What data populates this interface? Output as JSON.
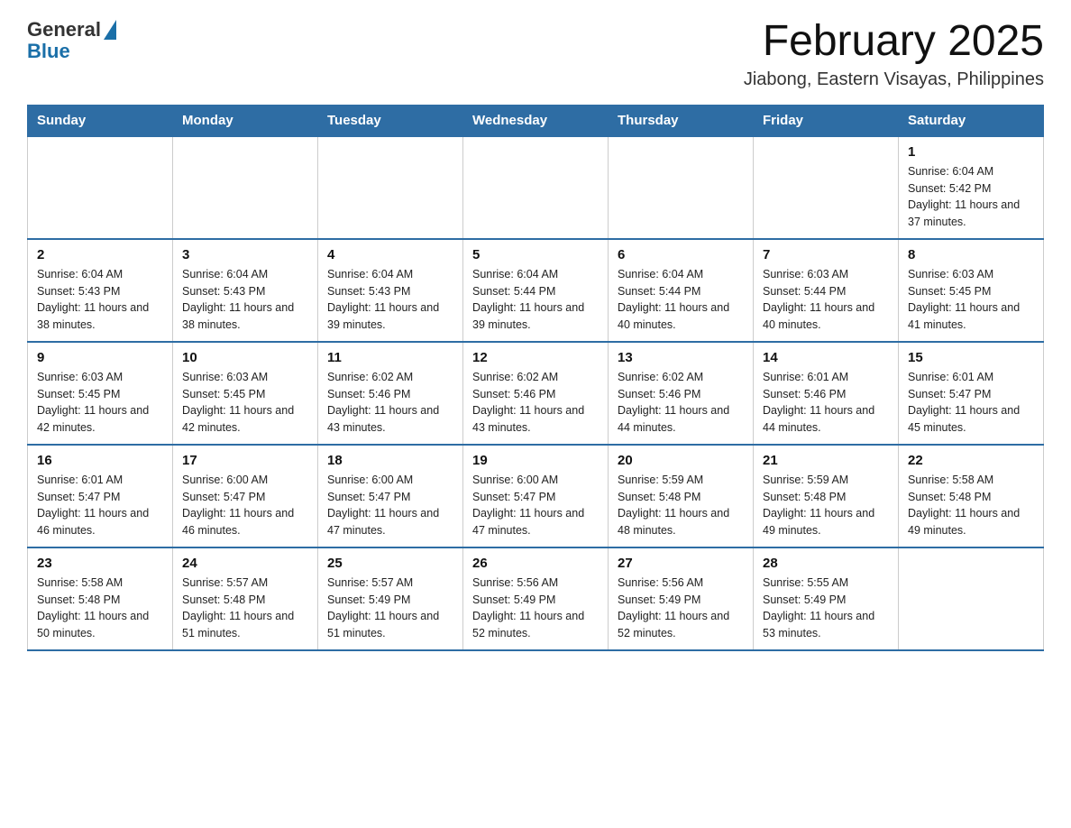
{
  "header": {
    "logo_general": "General",
    "logo_blue": "Blue",
    "main_title": "February 2025",
    "subtitle": "Jiabong, Eastern Visayas, Philippines"
  },
  "days_of_week": [
    "Sunday",
    "Monday",
    "Tuesday",
    "Wednesday",
    "Thursday",
    "Friday",
    "Saturday"
  ],
  "weeks": [
    [
      {
        "day": "",
        "sunrise": "",
        "sunset": "",
        "daylight": ""
      },
      {
        "day": "",
        "sunrise": "",
        "sunset": "",
        "daylight": ""
      },
      {
        "day": "",
        "sunrise": "",
        "sunset": "",
        "daylight": ""
      },
      {
        "day": "",
        "sunrise": "",
        "sunset": "",
        "daylight": ""
      },
      {
        "day": "",
        "sunrise": "",
        "sunset": "",
        "daylight": ""
      },
      {
        "day": "",
        "sunrise": "",
        "sunset": "",
        "daylight": ""
      },
      {
        "day": "1",
        "sunrise": "Sunrise: 6:04 AM",
        "sunset": "Sunset: 5:42 PM",
        "daylight": "Daylight: 11 hours and 37 minutes."
      }
    ],
    [
      {
        "day": "2",
        "sunrise": "Sunrise: 6:04 AM",
        "sunset": "Sunset: 5:43 PM",
        "daylight": "Daylight: 11 hours and 38 minutes."
      },
      {
        "day": "3",
        "sunrise": "Sunrise: 6:04 AM",
        "sunset": "Sunset: 5:43 PM",
        "daylight": "Daylight: 11 hours and 38 minutes."
      },
      {
        "day": "4",
        "sunrise": "Sunrise: 6:04 AM",
        "sunset": "Sunset: 5:43 PM",
        "daylight": "Daylight: 11 hours and 39 minutes."
      },
      {
        "day": "5",
        "sunrise": "Sunrise: 6:04 AM",
        "sunset": "Sunset: 5:44 PM",
        "daylight": "Daylight: 11 hours and 39 minutes."
      },
      {
        "day": "6",
        "sunrise": "Sunrise: 6:04 AM",
        "sunset": "Sunset: 5:44 PM",
        "daylight": "Daylight: 11 hours and 40 minutes."
      },
      {
        "day": "7",
        "sunrise": "Sunrise: 6:03 AM",
        "sunset": "Sunset: 5:44 PM",
        "daylight": "Daylight: 11 hours and 40 minutes."
      },
      {
        "day": "8",
        "sunrise": "Sunrise: 6:03 AM",
        "sunset": "Sunset: 5:45 PM",
        "daylight": "Daylight: 11 hours and 41 minutes."
      }
    ],
    [
      {
        "day": "9",
        "sunrise": "Sunrise: 6:03 AM",
        "sunset": "Sunset: 5:45 PM",
        "daylight": "Daylight: 11 hours and 42 minutes."
      },
      {
        "day": "10",
        "sunrise": "Sunrise: 6:03 AM",
        "sunset": "Sunset: 5:45 PM",
        "daylight": "Daylight: 11 hours and 42 minutes."
      },
      {
        "day": "11",
        "sunrise": "Sunrise: 6:02 AM",
        "sunset": "Sunset: 5:46 PM",
        "daylight": "Daylight: 11 hours and 43 minutes."
      },
      {
        "day": "12",
        "sunrise": "Sunrise: 6:02 AM",
        "sunset": "Sunset: 5:46 PM",
        "daylight": "Daylight: 11 hours and 43 minutes."
      },
      {
        "day": "13",
        "sunrise": "Sunrise: 6:02 AM",
        "sunset": "Sunset: 5:46 PM",
        "daylight": "Daylight: 11 hours and 44 minutes."
      },
      {
        "day": "14",
        "sunrise": "Sunrise: 6:01 AM",
        "sunset": "Sunset: 5:46 PM",
        "daylight": "Daylight: 11 hours and 44 minutes."
      },
      {
        "day": "15",
        "sunrise": "Sunrise: 6:01 AM",
        "sunset": "Sunset: 5:47 PM",
        "daylight": "Daylight: 11 hours and 45 minutes."
      }
    ],
    [
      {
        "day": "16",
        "sunrise": "Sunrise: 6:01 AM",
        "sunset": "Sunset: 5:47 PM",
        "daylight": "Daylight: 11 hours and 46 minutes."
      },
      {
        "day": "17",
        "sunrise": "Sunrise: 6:00 AM",
        "sunset": "Sunset: 5:47 PM",
        "daylight": "Daylight: 11 hours and 46 minutes."
      },
      {
        "day": "18",
        "sunrise": "Sunrise: 6:00 AM",
        "sunset": "Sunset: 5:47 PM",
        "daylight": "Daylight: 11 hours and 47 minutes."
      },
      {
        "day": "19",
        "sunrise": "Sunrise: 6:00 AM",
        "sunset": "Sunset: 5:47 PM",
        "daylight": "Daylight: 11 hours and 47 minutes."
      },
      {
        "day": "20",
        "sunrise": "Sunrise: 5:59 AM",
        "sunset": "Sunset: 5:48 PM",
        "daylight": "Daylight: 11 hours and 48 minutes."
      },
      {
        "day": "21",
        "sunrise": "Sunrise: 5:59 AM",
        "sunset": "Sunset: 5:48 PM",
        "daylight": "Daylight: 11 hours and 49 minutes."
      },
      {
        "day": "22",
        "sunrise": "Sunrise: 5:58 AM",
        "sunset": "Sunset: 5:48 PM",
        "daylight": "Daylight: 11 hours and 49 minutes."
      }
    ],
    [
      {
        "day": "23",
        "sunrise": "Sunrise: 5:58 AM",
        "sunset": "Sunset: 5:48 PM",
        "daylight": "Daylight: 11 hours and 50 minutes."
      },
      {
        "day": "24",
        "sunrise": "Sunrise: 5:57 AM",
        "sunset": "Sunset: 5:48 PM",
        "daylight": "Daylight: 11 hours and 51 minutes."
      },
      {
        "day": "25",
        "sunrise": "Sunrise: 5:57 AM",
        "sunset": "Sunset: 5:49 PM",
        "daylight": "Daylight: 11 hours and 51 minutes."
      },
      {
        "day": "26",
        "sunrise": "Sunrise: 5:56 AM",
        "sunset": "Sunset: 5:49 PM",
        "daylight": "Daylight: 11 hours and 52 minutes."
      },
      {
        "day": "27",
        "sunrise": "Sunrise: 5:56 AM",
        "sunset": "Sunset: 5:49 PM",
        "daylight": "Daylight: 11 hours and 52 minutes."
      },
      {
        "day": "28",
        "sunrise": "Sunrise: 5:55 AM",
        "sunset": "Sunset: 5:49 PM",
        "daylight": "Daylight: 11 hours and 53 minutes."
      },
      {
        "day": "",
        "sunrise": "",
        "sunset": "",
        "daylight": ""
      }
    ]
  ]
}
